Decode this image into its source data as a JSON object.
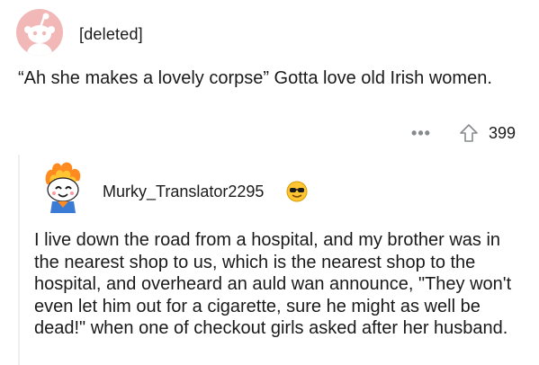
{
  "top_comment": {
    "author": "[deleted]",
    "avatar_icon": "deleted-user-avatar-icon",
    "body": "“Ah she makes a lovely corpse” Gotta love old Irish women.",
    "score": "399",
    "more_label": "•••"
  },
  "reply": {
    "author": "Murky_Translator2295",
    "avatar_icon": "fire-snoo-avatar-icon",
    "flair_icon": "sunglasses-emoji-icon",
    "body": "I live down the road from a hospital, and my brother was in the nearest shop to us, which is the nearest shop to the hospital, and overheard an auld wan announce, \"They won't even let him out for a cigarette, sure he might as well be dead!\" when one of checkout girls asked after her husband."
  },
  "colors": {
    "text": "#1a1a1b",
    "meta": "#878a8c",
    "thread_line": "#edeff1",
    "deleted_avatar_bg": "#f2b8b8"
  }
}
